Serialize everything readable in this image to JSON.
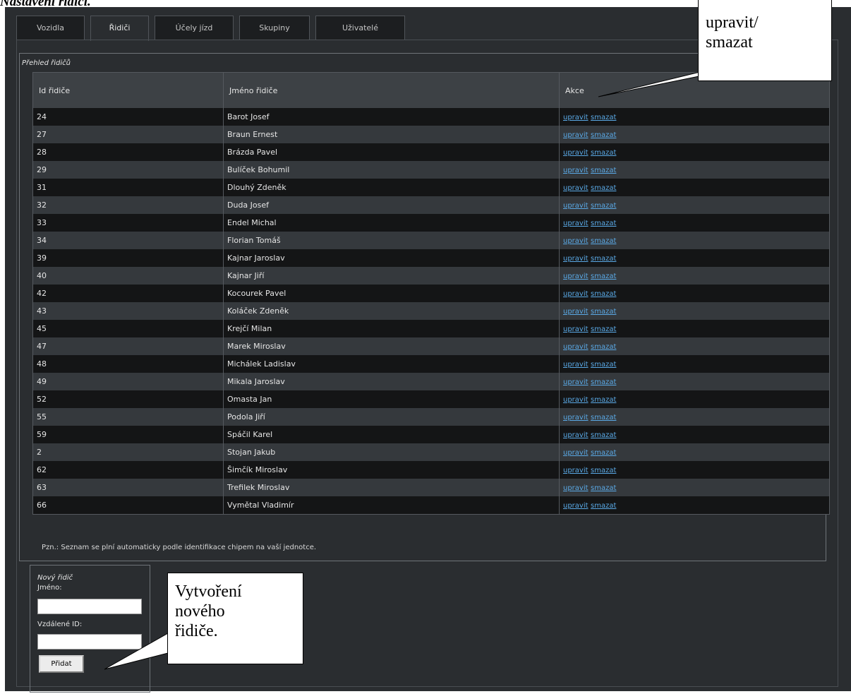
{
  "page_caption": "Nastavení řidiči.",
  "tabs": [
    {
      "label": "Vozidla",
      "active": false
    },
    {
      "label": "Řidiči",
      "active": true
    },
    {
      "label": "Účely jízd",
      "active": false
    },
    {
      "label": "Skupiny",
      "active": false
    },
    {
      "label": "Uživatelé",
      "active": false
    }
  ],
  "overview": {
    "title": "Přehled řidičů",
    "columns": [
      "Id řidiče",
      "Jméno řidiče",
      "Akce"
    ],
    "rows": [
      {
        "id": "24",
        "name": "Barot Josef"
      },
      {
        "id": "27",
        "name": "Braun Ernest"
      },
      {
        "id": "28",
        "name": "Brázda Pavel"
      },
      {
        "id": "29",
        "name": "Bulíček Bohumil"
      },
      {
        "id": "31",
        "name": "Dlouhý Zdeněk"
      },
      {
        "id": "32",
        "name": "Duda Josef"
      },
      {
        "id": "33",
        "name": "Endel Michal"
      },
      {
        "id": "34",
        "name": "Florian Tomáš"
      },
      {
        "id": "39",
        "name": "Kajnar Jaroslav"
      },
      {
        "id": "40",
        "name": "Kajnar Jiří"
      },
      {
        "id": "42",
        "name": "Kocourek Pavel"
      },
      {
        "id": "43",
        "name": "Koláček Zdeněk"
      },
      {
        "id": "45",
        "name": "Krejčí Milan"
      },
      {
        "id": "47",
        "name": "Marek Miroslav"
      },
      {
        "id": "48",
        "name": "Michálek Ladislav"
      },
      {
        "id": "49",
        "name": "Mikala Jaroslav"
      },
      {
        "id": "52",
        "name": "Omasta Jan"
      },
      {
        "id": "55",
        "name": "Podola Jiří"
      },
      {
        "id": "59",
        "name": "Spáčil Karel"
      },
      {
        "id": "2",
        "name": "Stojan Jakub"
      },
      {
        "id": "62",
        "name": "Šimčík Miroslav"
      },
      {
        "id": "63",
        "name": "Trefilek Miroslav"
      },
      {
        "id": "66",
        "name": "Vymětal Vladimír"
      }
    ],
    "edit_label": "upravit",
    "delete_label": "smazat",
    "note": "Pzn.: Seznam se plní automaticky podle identifikace chipem na vaší jednotce."
  },
  "new_driver": {
    "title": "Nový řidič",
    "name_label": "Jméno:",
    "name_value": "",
    "remote_id_label": "Vzdálené ID:",
    "remote_id_value": "",
    "add_label": "Přidat"
  },
  "callouts": {
    "actions": "upravit/\nsmazat",
    "create": "Vytvoření\nnového\nřidiče."
  }
}
